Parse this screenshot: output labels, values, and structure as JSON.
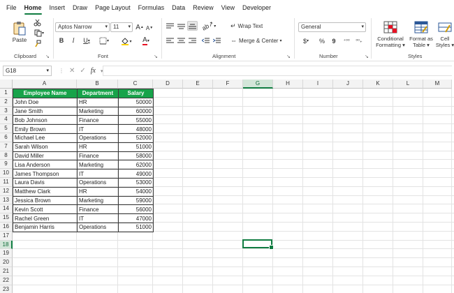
{
  "tabs": [
    {
      "label": "File",
      "active": false
    },
    {
      "label": "Home",
      "active": true
    },
    {
      "label": "Insert",
      "active": false
    },
    {
      "label": "Draw",
      "active": false
    },
    {
      "label": "Page Layout",
      "active": false
    },
    {
      "label": "Formulas",
      "active": false
    },
    {
      "label": "Data",
      "active": false
    },
    {
      "label": "Review",
      "active": false
    },
    {
      "label": "View",
      "active": false
    },
    {
      "label": "Developer",
      "active": false
    }
  ],
  "ribbon": {
    "clipboard": {
      "paste_label": "Paste",
      "group_label": "Clipboard"
    },
    "font": {
      "font_name": "Aptos Narrow",
      "font_size": "11",
      "grow": "A",
      "shrink": "A",
      "bold": "B",
      "italic": "I",
      "underline": "U",
      "group_label": "Font"
    },
    "alignment": {
      "wrap_text": "Wrap Text",
      "merge_center": "Merge & Center",
      "group_label": "Alignment"
    },
    "number": {
      "format": "General",
      "currency": "$",
      "percent": "%",
      "comma": "9",
      "group_label": "Number"
    },
    "styles": {
      "conditional_1": "Conditional",
      "conditional_2": "Formatting",
      "format_as_1": "Format as",
      "format_as_2": "Table",
      "cell_1": "Cell",
      "cell_2": "Styles",
      "group_label": "Styles"
    }
  },
  "formula_bar": {
    "name_box": "G18",
    "fx": "fx",
    "value": ""
  },
  "columns": [
    "A",
    "B",
    "C",
    "D",
    "E",
    "F",
    "G",
    "H",
    "I",
    "J",
    "K",
    "L",
    "M"
  ],
  "rows": [
    "1",
    "2",
    "3",
    "4",
    "5",
    "6",
    "7",
    "8",
    "9",
    "10",
    "11",
    "12",
    "13",
    "14",
    "15",
    "16",
    "17",
    "18",
    "19",
    "20",
    "21",
    "22",
    "23"
  ],
  "table": {
    "headers": [
      "Employee Name",
      "Department",
      "Salary"
    ],
    "rows": [
      [
        "John Doe",
        "HR",
        "50000"
      ],
      [
        "Jane Smith",
        "Marketing",
        "60000"
      ],
      [
        "Bob Johnson",
        "Finance",
        "55000"
      ],
      [
        "Emily Brown",
        "IT",
        "48000"
      ],
      [
        "Michael Lee",
        "Operations",
        "52000"
      ],
      [
        "Sarah Wilson",
        "HR",
        "51000"
      ],
      [
        "David Miller",
        "Finance",
        "58000"
      ],
      [
        "Lisa Anderson",
        "Marketing",
        "62000"
      ],
      [
        "James Thompson",
        "IT",
        "49000"
      ],
      [
        "Laura Davis",
        "Operations",
        "53000"
      ],
      [
        "Matthew Clark",
        "HR",
        "54000"
      ],
      [
        "Jessica Brown",
        "Marketing",
        "59000"
      ],
      [
        "Kevin Scott",
        "Finance",
        "56000"
      ],
      [
        "Rachel Green",
        "IT",
        "47000"
      ],
      [
        "Benjamin Harris",
        "Operations",
        "51000"
      ]
    ]
  },
  "colors": {
    "accent": "#107c41",
    "header_fill": "#17a34a",
    "selected_header": "#d3e6d9"
  },
  "selected_cell": {
    "column": "G",
    "row": "18"
  }
}
